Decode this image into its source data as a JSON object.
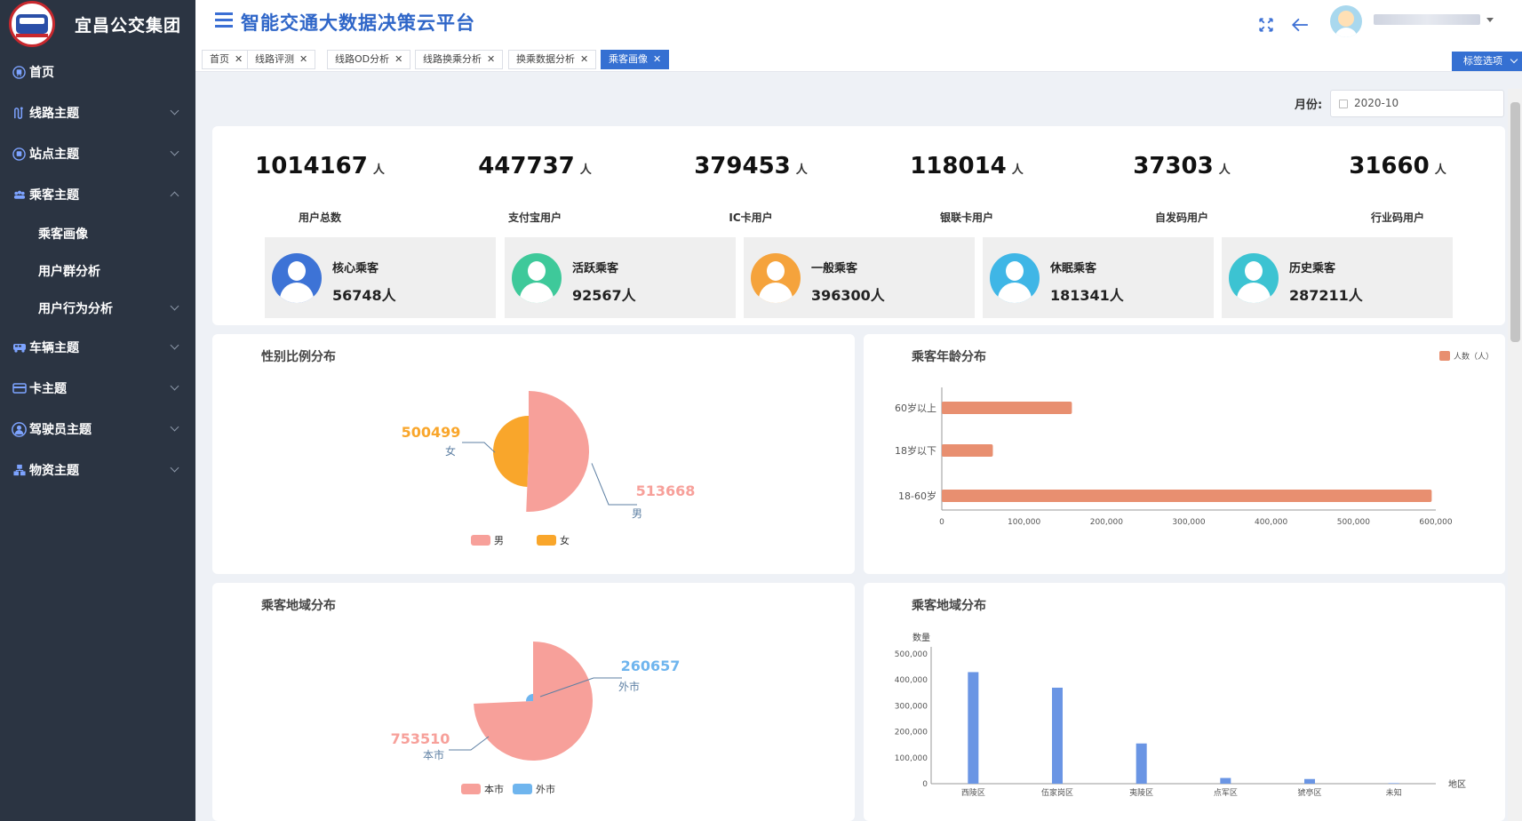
{
  "app": {
    "org_name": "宜昌公交集团",
    "platform_title": "智能交通大数据决策云平台"
  },
  "sidebar": {
    "items": [
      {
        "label": "首页",
        "icon": "bus-icon"
      },
      {
        "label": "线路主题",
        "icon": "route-icon"
      },
      {
        "label": "站点主题",
        "icon": "bus-icon"
      },
      {
        "label": "乘客主题",
        "icon": "passenger-icon",
        "expanded": true
      },
      {
        "label": "车辆主题",
        "icon": "vehicle-icon"
      },
      {
        "label": "卡主题",
        "icon": "card-icon"
      },
      {
        "label": "驾驶员主题",
        "icon": "driver-icon"
      },
      {
        "label": "物资主题",
        "icon": "supplies-icon"
      }
    ],
    "sub_items": [
      "乘客画像",
      "用户群分析",
      "用户行为分析"
    ]
  },
  "tabs": [
    {
      "label": "首页"
    },
    {
      "label": "线路评测"
    },
    {
      "label": "线路OD分析"
    },
    {
      "label": "线路换乘分析"
    },
    {
      "label": "换乘数据分析"
    },
    {
      "label": "乘客画像",
      "active": true
    }
  ],
  "tab_options_label": "标签选项",
  "filter": {
    "label": "月份:",
    "value": "2020-10"
  },
  "stats": [
    {
      "value": "1014167",
      "unit": "人",
      "label": "用户总数"
    },
    {
      "value": "447737",
      "unit": "人",
      "label": "支付宝用户"
    },
    {
      "value": "379453",
      "unit": "人",
      "label": "IC卡用户"
    },
    {
      "value": "118014",
      "unit": "人",
      "label": "银联卡用户"
    },
    {
      "value": "37303",
      "unit": "人",
      "label": "自发码用户"
    },
    {
      "value": "31660",
      "unit": "人",
      "label": "行业码用户"
    }
  ],
  "passenger_types": [
    {
      "name": "核心乘客",
      "value": "56748人",
      "color": "#3d73d6"
    },
    {
      "name": "活跃乘客",
      "value": "92567人",
      "color": "#3ec99a"
    },
    {
      "name": "一般乘客",
      "value": "396300人",
      "color": "#f5a33c"
    },
    {
      "name": "休眠乘客",
      "value": "181341人",
      "color": "#3fb6e6"
    },
    {
      "name": "历史乘客",
      "value": "287211人",
      "color": "#3cc3d2"
    }
  ],
  "chart_data": [
    {
      "type": "pie",
      "title": "性别比例分布",
      "slices": [
        {
          "name": "男",
          "value": 513668,
          "label": "513668",
          "color": "#f7a09a"
        },
        {
          "name": "女",
          "value": 500499,
          "label": "500499",
          "color": "#f9a62b"
        }
      ],
      "legend": [
        "男",
        "女"
      ]
    },
    {
      "type": "bar",
      "orientation": "horizontal",
      "title": "乘客年龄分布",
      "legend": "人数（人）",
      "categories": [
        "60岁以上",
        "18岁以下",
        "18-60岁"
      ],
      "values": [
        158000,
        62000,
        595000
      ],
      "xlim": [
        0,
        600000
      ],
      "ticks": [
        "0",
        "100,000",
        "200,000",
        "300,000",
        "400,000",
        "500,000",
        "600,000"
      ],
      "color": "#e88f70"
    },
    {
      "type": "pie",
      "title": "乘客地域分布",
      "slices": [
        {
          "name": "本市",
          "value": 753510,
          "label": "753510",
          "color": "#f7a09a"
        },
        {
          "name": "外市",
          "value": 260657,
          "label": "260657",
          "color": "#6fb5ee"
        }
      ],
      "legend": [
        "本市",
        "外市"
      ]
    },
    {
      "type": "bar",
      "title": "乘客地域分布",
      "ylabel": "数量",
      "xlabel": "地区",
      "categories": [
        "西陵区",
        "伍家岗区",
        "夷陵区",
        "点军区",
        "猇亭区",
        "未知"
      ],
      "values": [
        430000,
        370000,
        155000,
        22000,
        18000,
        2000
      ],
      "ylim": [
        0,
        500000
      ],
      "ticks": [
        "0",
        "100,000",
        "200,000",
        "300,000",
        "400,000",
        "500,000"
      ],
      "color": "#6a95e4"
    }
  ]
}
